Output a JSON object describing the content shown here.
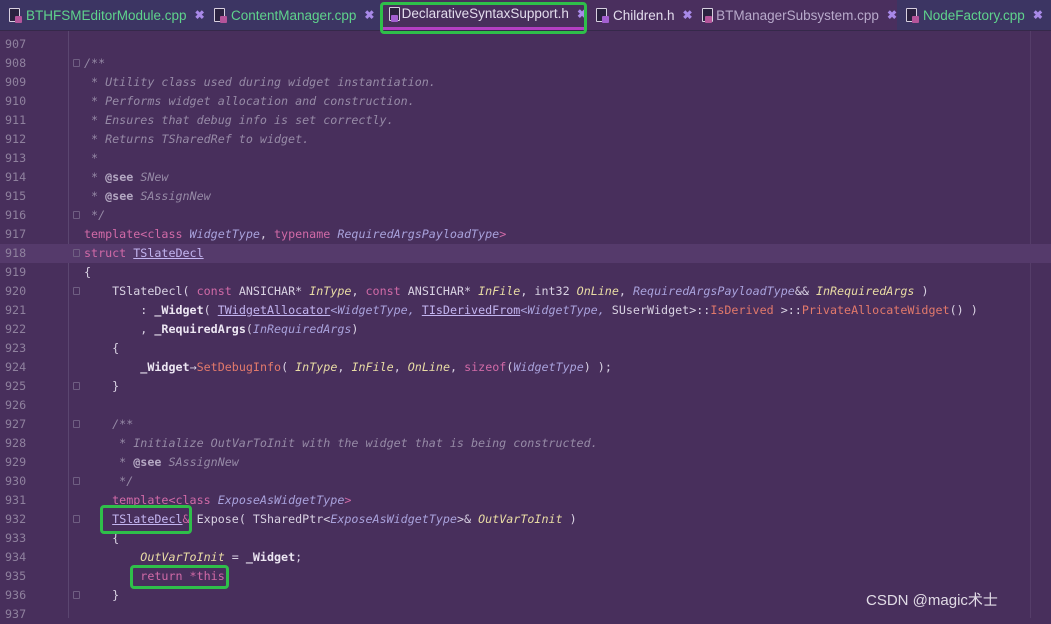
{
  "tabs": [
    {
      "label": "BTHFSMEditorModule.cpp",
      "type": "cpp",
      "style": "green"
    },
    {
      "label": "ContentManager.cpp",
      "type": "cpp",
      "style": "green"
    },
    {
      "label": "DeclarativeSyntaxSupport.h",
      "type": "h",
      "style": "white",
      "active": true
    },
    {
      "label": "Children.h",
      "type": "h",
      "style": "white"
    },
    {
      "label": "BTManagerSubsystem.cpp",
      "type": "cpp",
      "style": "gray"
    },
    {
      "label": "NodeFactory.cpp",
      "type": "cpp",
      "style": "green"
    }
  ],
  "close_glyph": "✖",
  "current_line": 918,
  "lines": [
    {
      "num": "907",
      "tokens": []
    },
    {
      "num": "908",
      "fold": true,
      "tokens": [
        [
          "c",
          "/**"
        ]
      ]
    },
    {
      "num": "909",
      "tokens": [
        [
          "c",
          " * Utility class used during widget instantiation."
        ]
      ]
    },
    {
      "num": "910",
      "tokens": [
        [
          "c",
          " * Performs widget allocation and construction."
        ]
      ]
    },
    {
      "num": "911",
      "tokens": [
        [
          "c",
          " * Ensures that debug info is set correctly."
        ]
      ]
    },
    {
      "num": "912",
      "tokens": [
        [
          "c",
          " * Returns TSharedRef to widget."
        ]
      ]
    },
    {
      "num": "913",
      "tokens": [
        [
          "c",
          " *"
        ]
      ]
    },
    {
      "num": "914",
      "tokens": [
        [
          "c",
          " * "
        ],
        [
          "cd",
          "@see"
        ],
        [
          "c",
          " SNew"
        ]
      ]
    },
    {
      "num": "915",
      "tokens": [
        [
          "c",
          " * "
        ],
        [
          "cd",
          "@see"
        ],
        [
          "c",
          " SAssignNew"
        ]
      ]
    },
    {
      "num": "916",
      "fold": true,
      "tokens": [
        [
          "c",
          " */"
        ]
      ]
    },
    {
      "num": "917",
      "tokens": [
        [
          "k",
          "template<class"
        ],
        [
          "t",
          " WidgetType"
        ],
        [
          "n",
          ", "
        ],
        [
          "k",
          "typename"
        ],
        [
          "t",
          " RequiredArgsPayloadType"
        ],
        [
          "k",
          ">"
        ]
      ]
    },
    {
      "num": "918",
      "fold": true,
      "tokens": [
        [
          "k",
          "struct "
        ],
        [
          "u",
          "TSlateDecl"
        ]
      ]
    },
    {
      "num": "919",
      "tokens": [
        [
          "n",
          "{"
        ]
      ]
    },
    {
      "num": "920",
      "fold": true,
      "tokens": [
        [
          "n",
          "    TSlateDecl( "
        ],
        [
          "k",
          "const "
        ],
        [
          "n",
          "ANSICHAR* "
        ],
        [
          "p",
          "InType"
        ],
        [
          "n",
          ", "
        ],
        [
          "k",
          "const "
        ],
        [
          "n",
          "ANSICHAR* "
        ],
        [
          "p",
          "InFile"
        ],
        [
          "n",
          ", int32 "
        ],
        [
          "p",
          "OnLine"
        ],
        [
          "n",
          ", "
        ],
        [
          "t",
          "RequiredArgsPayloadType"
        ],
        [
          "n",
          "&& "
        ],
        [
          "p",
          "InRequiredArgs"
        ],
        [
          "n",
          " )"
        ]
      ]
    },
    {
      "num": "921",
      "tokens": [
        [
          "n",
          "        : "
        ],
        [
          "b",
          "_Widget"
        ],
        [
          "n",
          "( "
        ],
        [
          "u",
          "TWidgetAllocator"
        ],
        [
          "t",
          "<WidgetType, "
        ],
        [
          "u",
          "TIsDerivedFrom"
        ],
        [
          "t",
          "<WidgetType, "
        ],
        [
          "n",
          "SUserWidget>::"
        ],
        [
          "m",
          "IsDerived "
        ],
        [
          "n",
          ">::"
        ],
        [
          "f",
          "PrivateAllocateWidget"
        ],
        [
          "n",
          "() )"
        ]
      ]
    },
    {
      "num": "922",
      "tokens": [
        [
          "n",
          "        , "
        ],
        [
          "b",
          "_RequiredArgs"
        ],
        [
          "n",
          "("
        ],
        [
          "t",
          "InRequiredArgs"
        ],
        [
          "n",
          ")"
        ]
      ]
    },
    {
      "num": "923",
      "tokens": [
        [
          "n",
          "    {"
        ]
      ]
    },
    {
      "num": "924",
      "tokens": [
        [
          "n",
          "        "
        ],
        [
          "b",
          "_Widget"
        ],
        [
          "n",
          "→"
        ],
        [
          "f",
          "SetDebugInfo"
        ],
        [
          "n",
          "( "
        ],
        [
          "p",
          "InType"
        ],
        [
          "n",
          ", "
        ],
        [
          "p",
          "InFile"
        ],
        [
          "n",
          ", "
        ],
        [
          "p",
          "OnLine"
        ],
        [
          "n",
          ", "
        ],
        [
          "k",
          "sizeof"
        ],
        [
          "n",
          "("
        ],
        [
          "t",
          "WidgetType"
        ],
        [
          "n",
          ") );"
        ]
      ]
    },
    {
      "num": "925",
      "fold": true,
      "tokens": [
        [
          "n",
          "    }"
        ]
      ]
    },
    {
      "num": "926",
      "tokens": []
    },
    {
      "num": "927",
      "fold": true,
      "tokens": [
        [
          "c",
          "    /**"
        ]
      ]
    },
    {
      "num": "928",
      "tokens": [
        [
          "c",
          "     * Initialize OutVarToInit with the widget that is being constructed."
        ]
      ]
    },
    {
      "num": "929",
      "tokens": [
        [
          "c",
          "     * "
        ],
        [
          "cd",
          "@see"
        ],
        [
          "c",
          " SAssignNew"
        ]
      ]
    },
    {
      "num": "930",
      "fold": true,
      "tokens": [
        [
          "c",
          "     */"
        ]
      ]
    },
    {
      "num": "931",
      "tokens": [
        [
          "k",
          "    template<class "
        ],
        [
          "t",
          "ExposeAsWidgetType"
        ],
        [
          "k",
          ">"
        ]
      ]
    },
    {
      "num": "932",
      "fold": true,
      "tokens": [
        [
          "n",
          "    "
        ],
        [
          "u",
          "TSlateDecl"
        ],
        [
          "k",
          "&"
        ],
        [
          "n",
          " Expose( TSharedPtr<"
        ],
        [
          "t",
          "ExposeAsWidgetType"
        ],
        [
          "n",
          ">& "
        ],
        [
          "p",
          "OutVarToInit"
        ],
        [
          "n",
          " )"
        ]
      ]
    },
    {
      "num": "933",
      "tokens": [
        [
          "n",
          "    {"
        ]
      ]
    },
    {
      "num": "934",
      "tokens": [
        [
          "p",
          "        OutVarToInit"
        ],
        [
          "n",
          " = "
        ],
        [
          "b",
          "_Widget"
        ],
        [
          "n",
          ";"
        ]
      ]
    },
    {
      "num": "935",
      "tokens": [
        [
          "n",
          "        "
        ],
        [
          "k",
          "return *this"
        ]
      ]
    },
    {
      "num": "936",
      "fold": true,
      "tokens": [
        [
          "n",
          "    }"
        ]
      ]
    },
    {
      "num": "937",
      "tokens": []
    }
  ],
  "highlight_color": "#2fbf4a",
  "watermark": "CSDN @magic术士"
}
